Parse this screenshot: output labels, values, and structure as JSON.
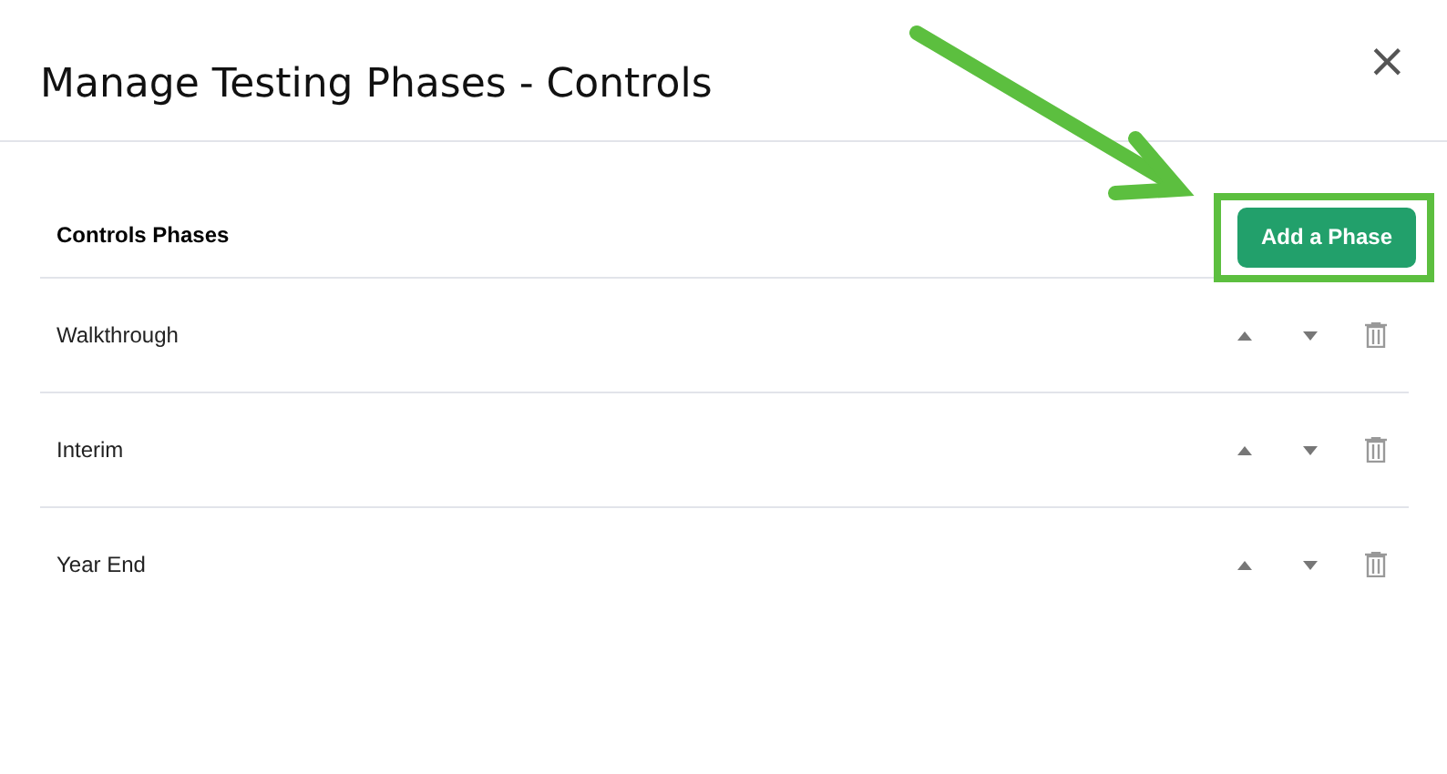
{
  "dialog": {
    "title": "Manage Testing Phases - Controls",
    "close": "×"
  },
  "section": {
    "title": "Controls Phases",
    "add_button": "Add a Phase",
    "highlighted": true
  },
  "phases": [
    {
      "name": "Walkthrough"
    },
    {
      "name": "Interim"
    },
    {
      "name": "Year End"
    }
  ]
}
